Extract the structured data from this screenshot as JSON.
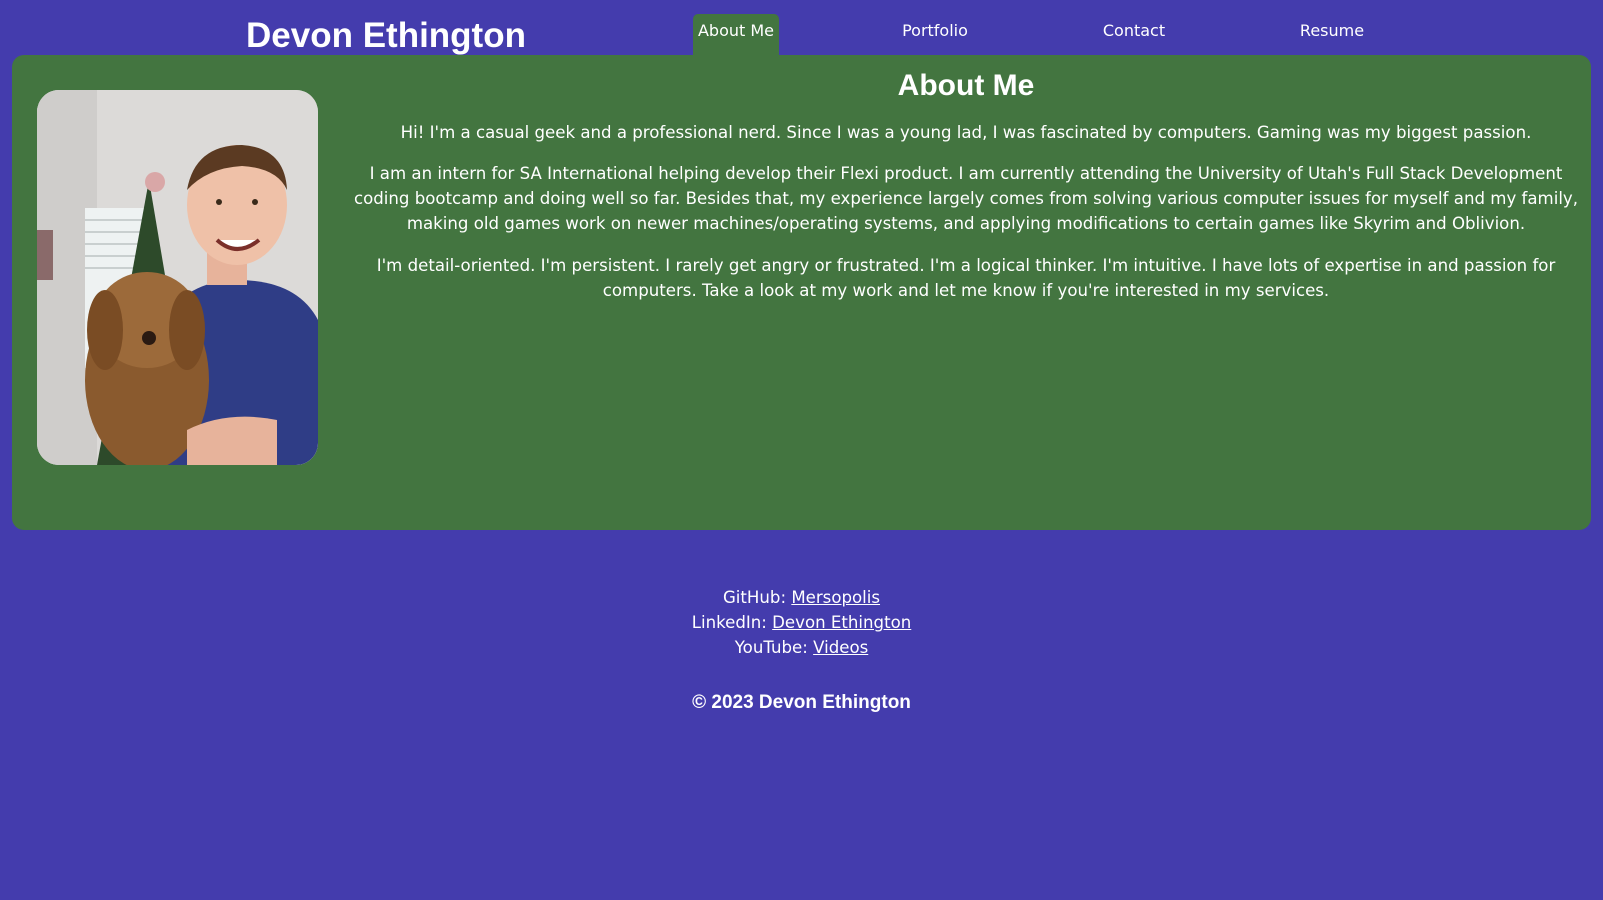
{
  "header": {
    "site_title": "Devon Ethington"
  },
  "nav": {
    "items": [
      {
        "label": "About Me",
        "active": true
      },
      {
        "label": "Portfolio",
        "active": false
      },
      {
        "label": "Contact",
        "active": false
      },
      {
        "label": "Resume",
        "active": false
      }
    ]
  },
  "about": {
    "heading": "About Me",
    "paragraphs": [
      "Hi! I'm a casual geek and a professional nerd. Since I was a young lad, I was fascinated by computers. Gaming was my biggest passion.",
      "I am an intern for SA International helping develop their Flexi product. I am currently attending the University of Utah's Full Stack Development coding bootcamp and doing well so far. Besides that, my experience largely comes from solving various computer issues for myself and my family, making old games work on newer machines/operating systems, and applying modifications to certain games like Skyrim and Oblivion.",
      "I'm detail-oriented. I'm persistent. I rarely get angry or frustrated. I'm a logical thinker. I'm intuitive. I have lots of expertise in and passion for computers. Take a look at my work and let me know if you're interested in my services."
    ]
  },
  "footer": {
    "links": [
      {
        "prefix": "GitHub:",
        "text": "Mersopolis"
      },
      {
        "prefix": "LinkedIn:",
        "text": "Devon Ethington"
      },
      {
        "prefix": "YouTube:",
        "text": "Videos"
      }
    ],
    "copyright": "© 2023 Devon Ethington"
  },
  "colors": {
    "page_background": "#443cad",
    "card_background": "#437540",
    "text": "#ffffff"
  }
}
